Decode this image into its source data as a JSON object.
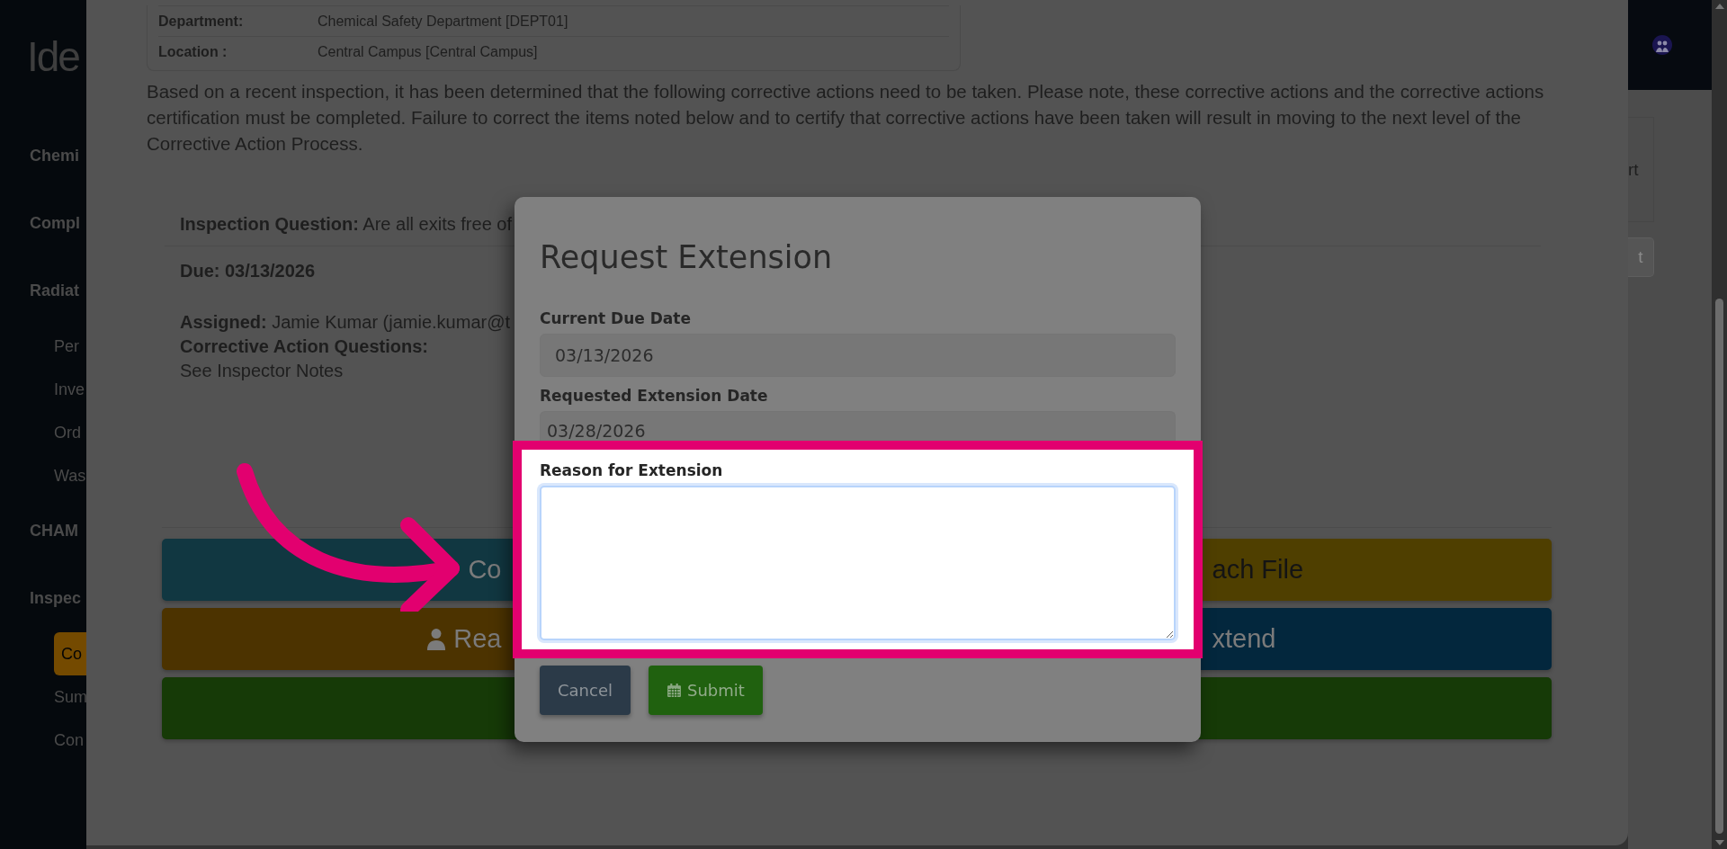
{
  "sidebar": {
    "logo": "Ide",
    "items": [
      {
        "label": "Chemi",
        "kind": "section",
        "selected": false
      },
      {
        "label": "Compl",
        "kind": "section",
        "selected": false
      },
      {
        "label": "Radiat",
        "kind": "section",
        "selected": false
      },
      {
        "label": "Per",
        "kind": "link",
        "selected": false
      },
      {
        "label": "Inve",
        "kind": "link",
        "selected": false
      },
      {
        "label": "Ord",
        "kind": "link",
        "selected": false
      },
      {
        "label": "Was",
        "kind": "link",
        "selected": false
      },
      {
        "label": "CHAM",
        "kind": "section",
        "selected": false
      },
      {
        "label": "Inspec",
        "kind": "section",
        "selected": false
      },
      {
        "label": "Co",
        "kind": "link",
        "selected": true
      },
      {
        "label": "Sum",
        "kind": "link",
        "selected": false
      },
      {
        "label": "Con",
        "kind": "link",
        "selected": false
      }
    ]
  },
  "details": [
    {
      "label": "Department:",
      "value": "Chemical Safety Department [DEPT01]"
    },
    {
      "label": "Location :",
      "value": "Central Campus [Central Campus]"
    }
  ],
  "notice": "Based on a recent inspection, it has been determined that the following corrective actions need to be taken. Please note, these corrective actions and the corrective actions certification must be completed. Failure to correct the items noted below and to certify that corrective actions have been taken will result in moving to the next level of the Corrective Action Process.",
  "finding": {
    "question_label": "Inspection Question:",
    "question": "Are all exits free of",
    "due": "Due: 03/13/2026",
    "assigned_label": "Assigned:",
    "assigned": "Jamie Kumar (jamie.kumar@t",
    "questions_label": "Corrective Action Questions:",
    "questions": "See Inspector Notes"
  },
  "actions": [
    [
      {
        "label": "Co",
        "kind": "find",
        "color": "#113741"
      },
      {
        "label": "ach File",
        "kind": "attach",
        "color": "#4f3f00"
      }
    ],
    [
      {
        "label": "Rea",
        "kind": "assign",
        "color": "#4c3300"
      },
      {
        "label": "xtend",
        "kind": "extend",
        "color": "#03273d"
      }
    ],
    [
      {
        "kind": "complete",
        "color": "#163a07"
      }
    ]
  ],
  "right_panel": {
    "card_text": "rt",
    "button": "t"
  },
  "modal": {
    "title": "Request Extension",
    "fields": [
      {
        "label": "Current Due Date",
        "value": "03/13/2026",
        "disabled": true,
        "cut": false
      },
      {
        "label": "Requested Extension Date",
        "value": "03/28/2026",
        "disabled": true,
        "cut": true
      }
    ],
    "reason": {
      "label": "Reason for Extension",
      "highlighted": true
    },
    "buttons": [
      {
        "label": "Cancel",
        "kind": "cancel"
      },
      {
        "label": "Submit",
        "kind": "submit"
      }
    ]
  }
}
